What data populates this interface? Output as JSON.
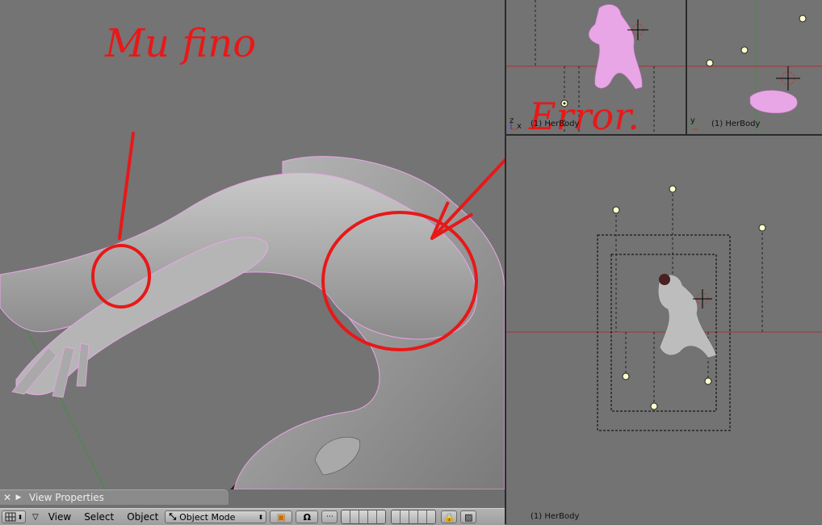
{
  "annotations": {
    "text_left": "Mu fino",
    "text_right": "Error."
  },
  "viewports": {
    "top_left_label": "(1) HerBody",
    "top_right_label": "(1) HerBody",
    "bottom_label": "(1) HerBody",
    "axis_z": "z",
    "axis_x": "x",
    "axis_y": "y"
  },
  "panel": {
    "close_glyph": "✕",
    "expand_glyph": "▶",
    "title": "View Properties"
  },
  "header": {
    "menus": [
      "View",
      "Select",
      "Object"
    ],
    "mode": "Object Mode",
    "updown_glyph": "⬍",
    "magnet_glyph": "Ω"
  },
  "colors": {
    "annotation_red": "#e81818",
    "selection_pink": "#e9a6e6",
    "viewport_grey": "#737373",
    "floor_dark_red": "#3a1a1a"
  }
}
